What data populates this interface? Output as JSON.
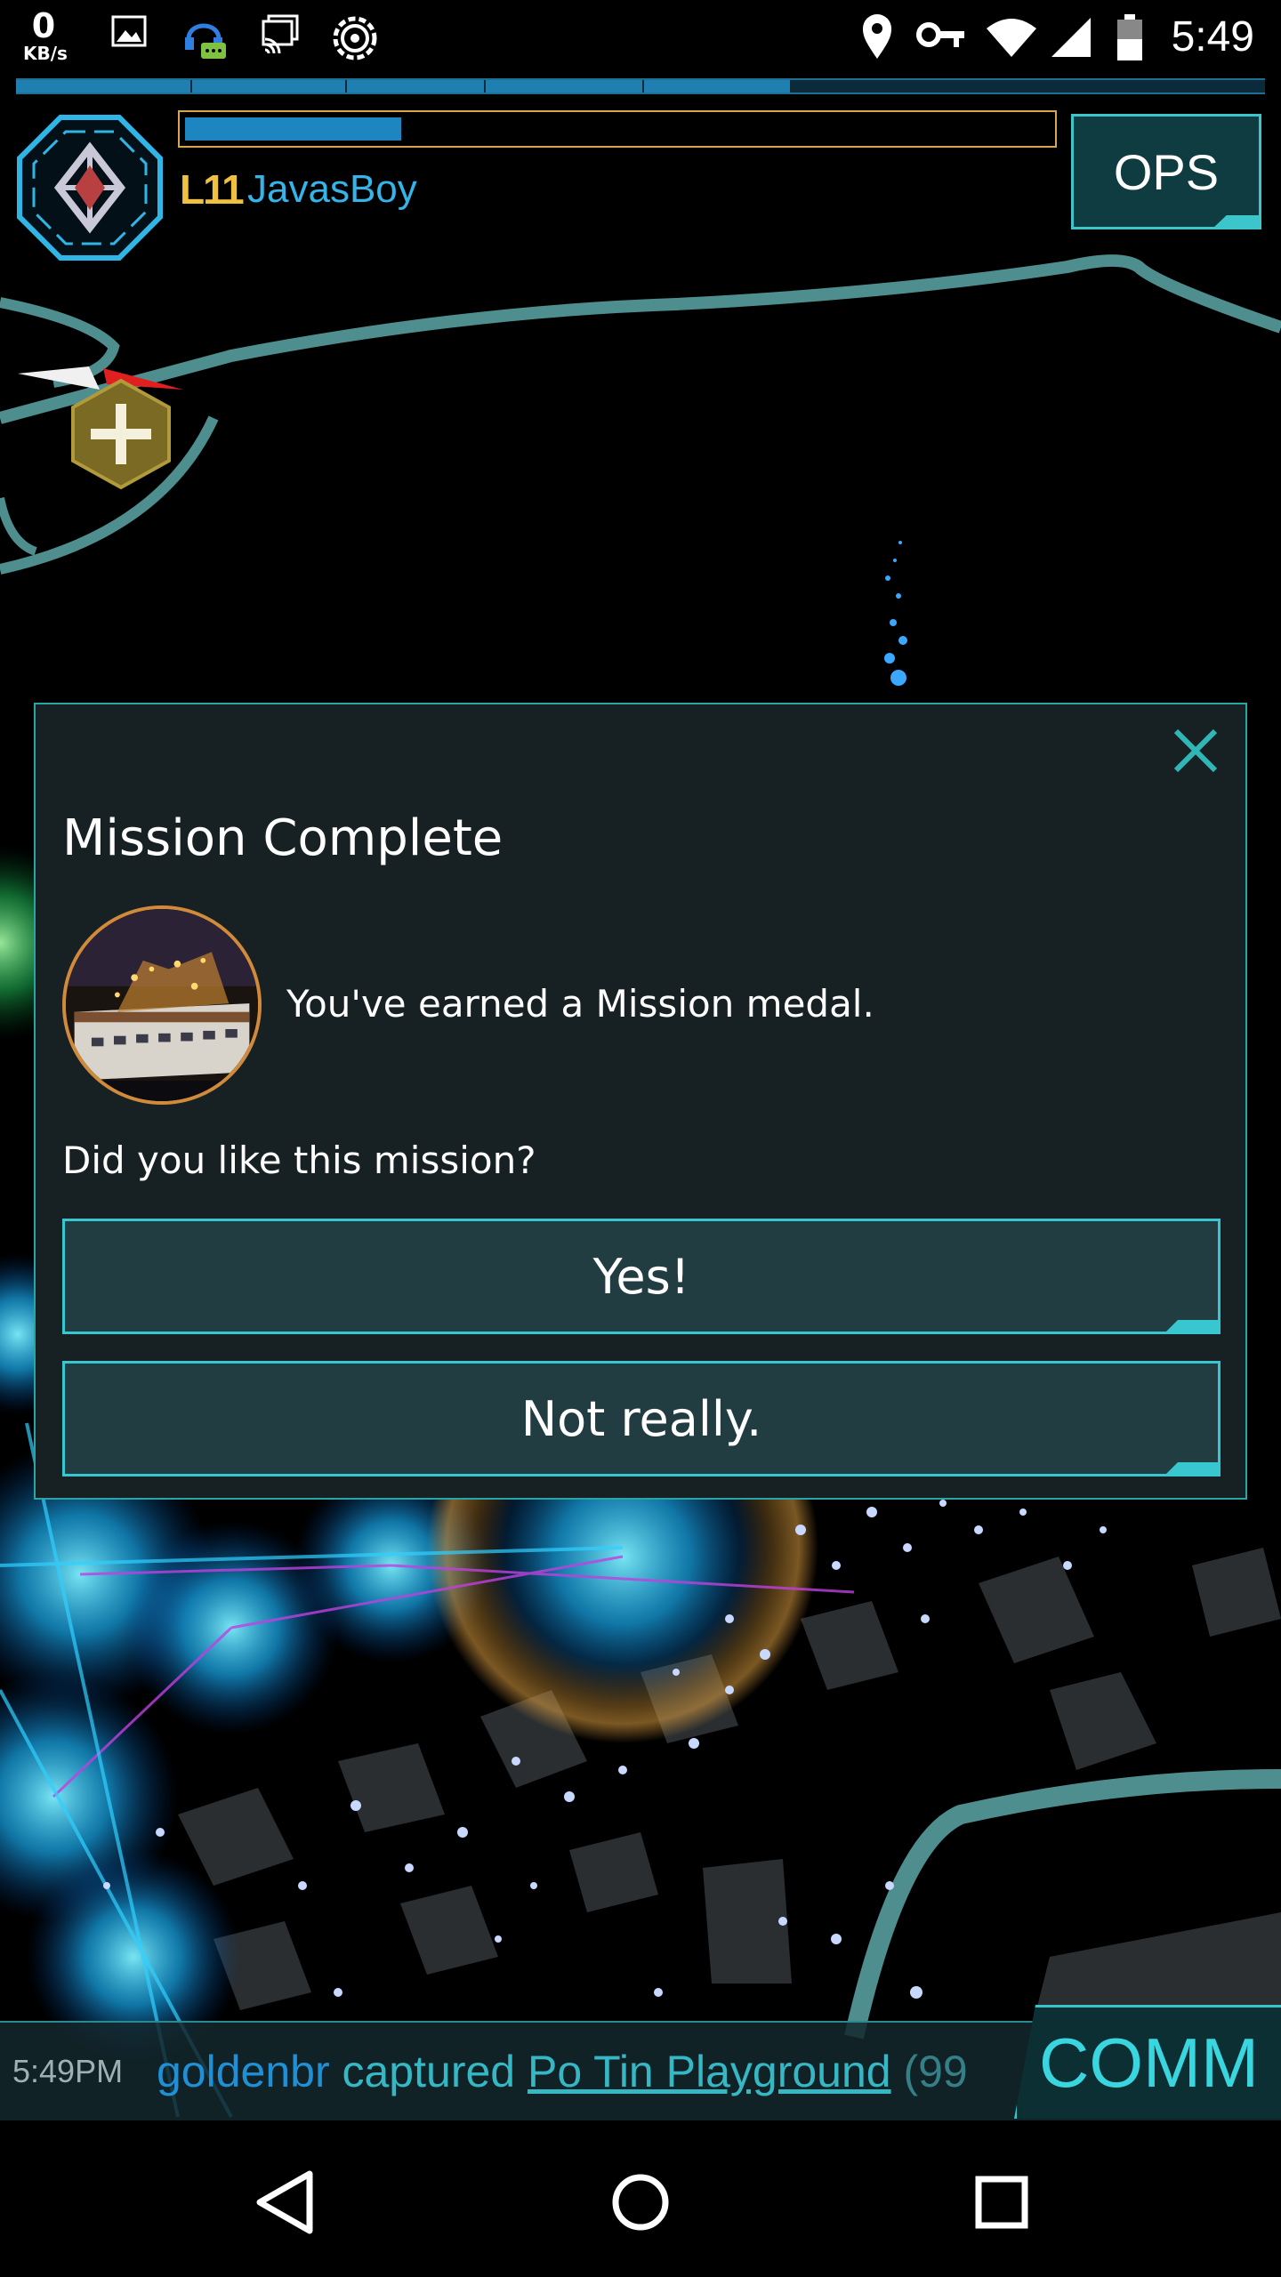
{
  "status_bar": {
    "net_speed_value": "0",
    "net_speed_unit": "KB/s",
    "time": "5:49",
    "icons": [
      "image-icon",
      "headset-chat-icon",
      "cast-icon",
      "settings-gear-icon",
      "location-icon",
      "vpn-key-icon",
      "wifi-icon",
      "signal-icon",
      "battery-icon"
    ]
  },
  "hud": {
    "level": "L11",
    "agent_name": "JavasBoy",
    "xp_fill": 0.25,
    "top_bar_fill": 0.62,
    "ops_label": "OPS"
  },
  "modal": {
    "title": "Mission Complete",
    "medal_text": "You've earned a Mission medal.",
    "question": "Did you like this mission?",
    "yes_label": "Yes!",
    "no_label": "Not really."
  },
  "comm": {
    "time": "5:49PM",
    "player": "goldenbr",
    "action": " captured ",
    "portal": "Po Tin Playground",
    "tail": " (99",
    "button_label": "COMM"
  },
  "colors": {
    "accent_teal": "#38c6d0",
    "enlightened_green": "#2fd46a",
    "resistance_blue": "#1f8fd6",
    "level_gold": "#f0c040"
  },
  "nav": {
    "icons": [
      "back-icon",
      "home-icon",
      "recents-icon"
    ]
  }
}
